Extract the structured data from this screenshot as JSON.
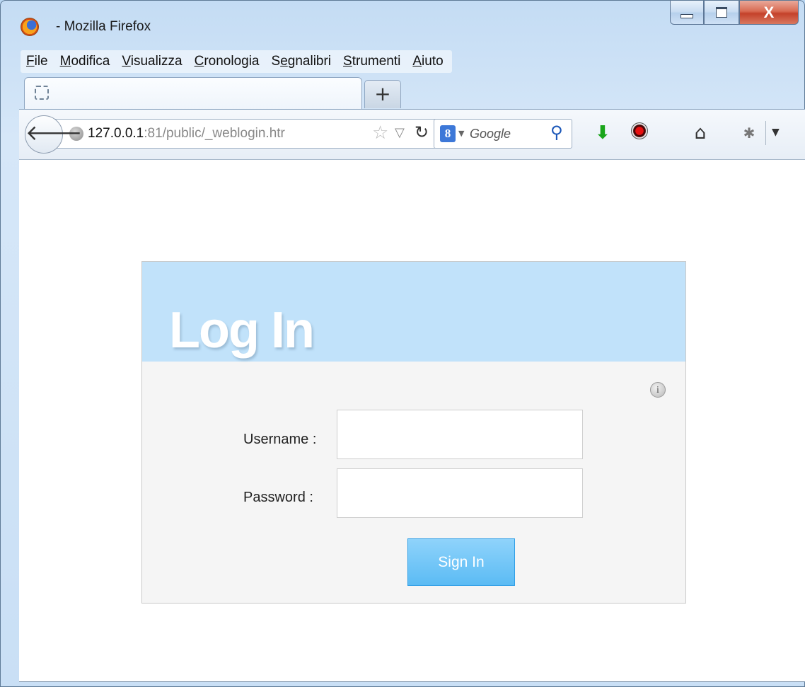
{
  "window": {
    "title": "- Mozilla Firefox",
    "close_glyph": "X"
  },
  "menu": {
    "items": [
      {
        "label_u": "F",
        "label_rest": "ile"
      },
      {
        "label_u": "M",
        "label_rest": "odifica"
      },
      {
        "label_u": "V",
        "label_rest": "isualizza"
      },
      {
        "label_u": "C",
        "label_rest": "ronologia"
      },
      {
        "label_pre": "S",
        "label_u": "e",
        "label_rest": "gnalibri"
      },
      {
        "label_u": "S",
        "label_rest": "trumenti"
      },
      {
        "label_u": "A",
        "label_rest": "iuto"
      }
    ]
  },
  "tabs": {
    "new_tab_glyph": "+"
  },
  "navbar": {
    "back_glyph": "🡐",
    "url_host": "127.0.0.1",
    "url_rest": ":81/public/_weblogin.htr",
    "search_engine_badge": "8",
    "search_placeholder": "Google"
  },
  "icons": {
    "firefox": "firefox-logo",
    "back": "back-arrow-icon",
    "globe": "globe-icon",
    "star": "bookmark-star-icon",
    "reload": "reload-icon",
    "search": "magnifier-icon",
    "download": "download-arrow-icon",
    "record": "record-icon",
    "home": "home-icon",
    "bug": "addon-bug-icon",
    "info": "info-icon"
  },
  "login": {
    "title": "Log In",
    "info_glyph": "i",
    "username_label": "Username :",
    "password_label": "Password  :",
    "username_value": "",
    "password_value": "",
    "submit_label": "Sign In"
  },
  "colors": {
    "header_bg": "#c1e2fa",
    "panel_bg": "#f5f5f5",
    "button_bg": "#5bbbf4"
  }
}
